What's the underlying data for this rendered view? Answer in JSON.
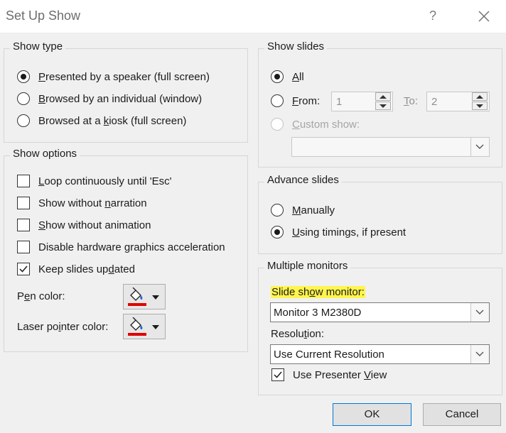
{
  "window": {
    "title": "Set Up Show",
    "help_label": "?"
  },
  "show_type": {
    "legend": "Show type",
    "options": [
      {
        "pre": "",
        "ul": "P",
        "post": "resented by a speaker (full screen)",
        "selected": true
      },
      {
        "pre": "",
        "ul": "B",
        "post": "rowsed by an individual (window)",
        "selected": false
      },
      {
        "pre": "Browsed at a ",
        "ul": "k",
        "post": "iosk (full screen)",
        "selected": false
      }
    ]
  },
  "show_options": {
    "legend": "Show options",
    "items": [
      {
        "pre": "",
        "ul": "L",
        "post": "oop continuously until 'Esc'",
        "checked": false
      },
      {
        "pre": "Show without ",
        "ul": "n",
        "post": "arration",
        "checked": false
      },
      {
        "pre": "",
        "ul": "S",
        "post": "how without animation",
        "checked": false
      },
      {
        "pre": "Disable hardware ",
        "ul": "g",
        "post": "raphics acceleration",
        "checked": false
      },
      {
        "pre": "Keep slides up",
        "ul": "d",
        "post": "ated",
        "checked": true
      }
    ],
    "pen_color": {
      "pre": "P",
      "ul": "e",
      "post": "n color:",
      "color": "#e00000"
    },
    "laser_color": {
      "pre": "Laser po",
      "ul": "i",
      "post": "nter color:",
      "color": "#e00000"
    }
  },
  "show_slides": {
    "legend": "Show slides",
    "all": {
      "pre": "",
      "ul": "A",
      "post": "ll",
      "selected": true
    },
    "from": {
      "pre": "",
      "ul": "F",
      "post": "rom:",
      "selected": false,
      "value": "1"
    },
    "to": {
      "pre": "",
      "ul": "T",
      "post": "o:",
      "value": "2"
    },
    "custom": {
      "pre": "",
      "ul": "C",
      "post": "ustom show:",
      "selected": false,
      "value": ""
    }
  },
  "advance_slides": {
    "legend": "Advance slides",
    "manually": {
      "pre": "",
      "ul": "M",
      "post": "anually",
      "selected": false
    },
    "timings": {
      "pre": "",
      "ul": "U",
      "post": "sing timings, if present",
      "selected": true
    }
  },
  "multiple_monitors": {
    "legend": "Multiple monitors",
    "monitor_label": {
      "pre": "Slide sh",
      "ul": "o",
      "post": "w monitor:"
    },
    "monitor_value": "Monitor 3 M2380D",
    "resolution_label": {
      "pre": "Resolu",
      "ul": "t",
      "post": "ion:"
    },
    "resolution_value": "Use Current Resolution",
    "presenter_view": {
      "pre": "Use Presenter ",
      "ul": "V",
      "post": "iew",
      "checked": true
    },
    "highlight_color": "#fff54d"
  },
  "buttons": {
    "ok": "OK",
    "cancel": "Cancel"
  }
}
